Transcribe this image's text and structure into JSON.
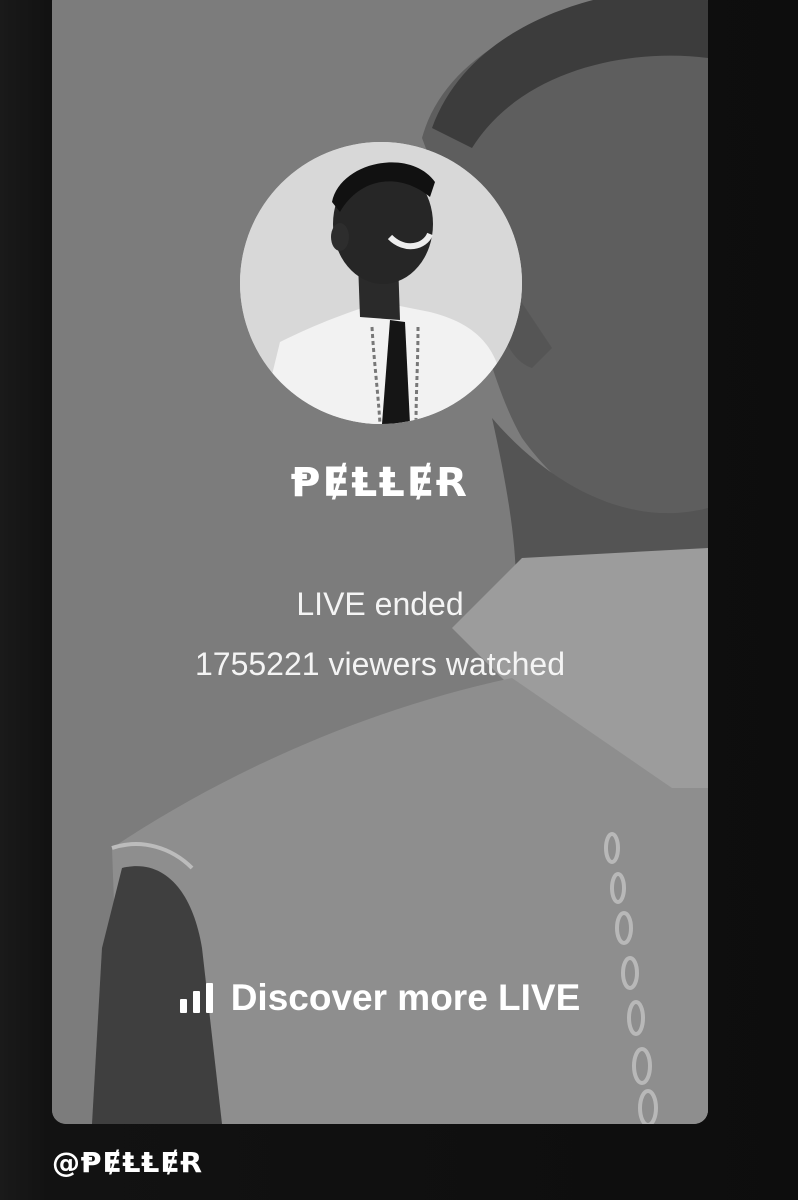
{
  "live": {
    "host_name": "ⱣɆⱠⱠɆɌ",
    "status": "LIVE ended",
    "viewers": "1755221 viewers watched",
    "discover_label": "Discover more LIVE",
    "discover_icon": "bar-chart-icon"
  },
  "footer": {
    "handle": "@ⱣɆⱠⱠɆɌ"
  },
  "colors": {
    "card_overlay": "#7a7a7a",
    "text": "#ffffff",
    "page_background": "#0c0c0c"
  }
}
